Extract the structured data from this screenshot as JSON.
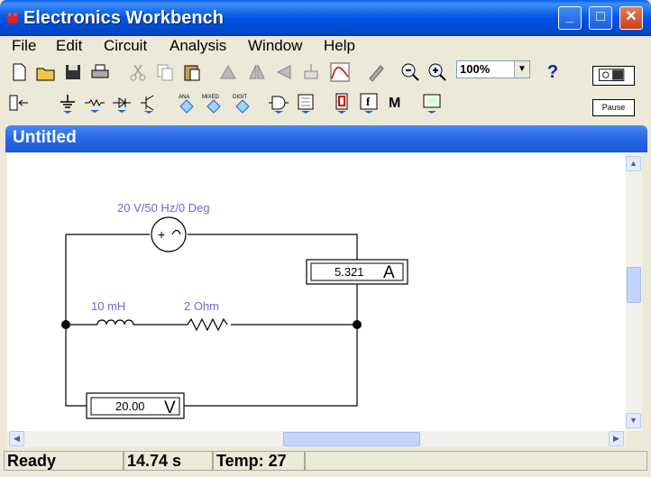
{
  "window": {
    "title": "Electronics Workbench",
    "minimize": "_",
    "maximize": "□",
    "close": "✕"
  },
  "menu": [
    "File",
    "Edit",
    "Circuit",
    "Analysis",
    "Window",
    "Help"
  ],
  "toolbar": {
    "zoom": "100%",
    "zoom_arrow": "▼",
    "help": "?",
    "pause_label": "Pause"
  },
  "parts_bin": {
    "ana": "ANA",
    "mixed": "MIXED",
    "digit": "DIGIT",
    "f": "f",
    "m": "M"
  },
  "document": {
    "title": "Untitled"
  },
  "circuit": {
    "source_label": "20 V/50 Hz/0 Deg",
    "inductor_label": "10 mH",
    "resistor_label": "2  Ohm",
    "ammeter_value": "5.321",
    "ammeter_unit": "A",
    "voltmeter_value": "20.00",
    "voltmeter_unit": "V"
  },
  "status": {
    "state": "Ready",
    "time": "14.74 s",
    "temp": "Temp:  27"
  }
}
